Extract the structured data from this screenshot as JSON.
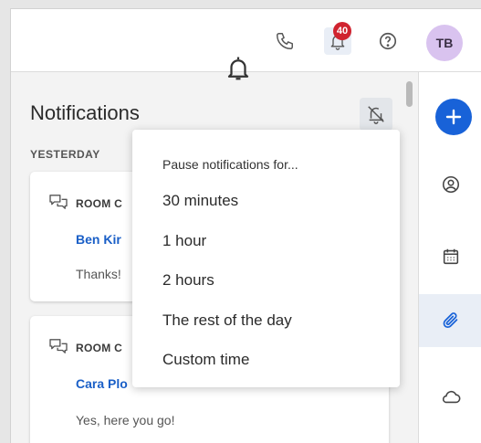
{
  "topbar": {
    "phone_icon": "phone-icon",
    "bell_icon": "bell-icon",
    "notification_count": "40",
    "help_icon": "help-circle-icon",
    "avatar_initials": "TB"
  },
  "panel": {
    "title": "Notifications",
    "section": "YESTERDAY",
    "cards": [
      {
        "room": "ROOM C",
        "name": "Ben Kir",
        "message": "Thanks!"
      },
      {
        "room": "ROOM C",
        "name": "Cara Plo",
        "message": "Yes, here you go!"
      }
    ]
  },
  "menu": {
    "header": "Pause notifications for...",
    "items": [
      "30 minutes",
      "1 hour",
      "2 hours",
      "The rest of the day",
      "Custom time"
    ]
  },
  "rail": {
    "items": [
      "add-icon",
      "user-circle-icon",
      "calendar-icon",
      "paperclip-icon",
      "cloud-icon"
    ]
  },
  "colors": {
    "accent": "#1862d8",
    "badge": "#d0232f",
    "avatar_bg": "#d9c3ef",
    "link": "#1a5fc7"
  }
}
